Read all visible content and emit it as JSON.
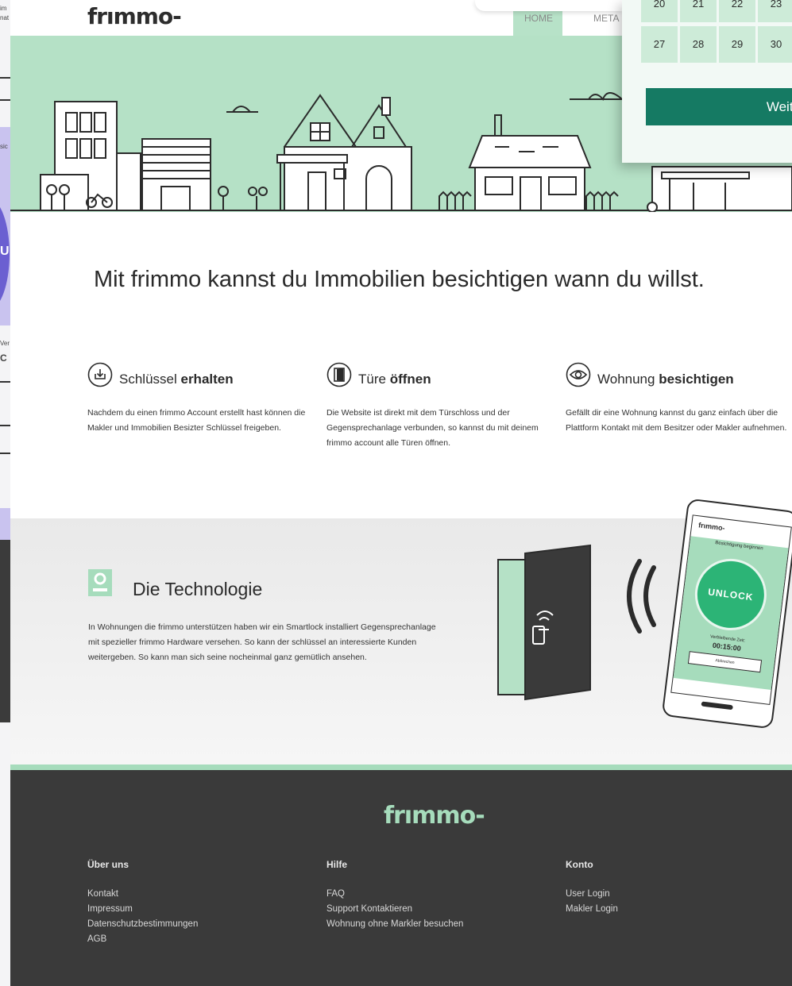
{
  "brand": {
    "logo": "frımmo-",
    "accent": "#a6dcbc",
    "dark": "#3a3a3a",
    "button": "#157a63"
  },
  "nav": {
    "home": "HOME",
    "meta": "META"
  },
  "calendar": {
    "row1": [
      "20",
      "21",
      "22",
      "23"
    ],
    "row2": [
      "27",
      "28",
      "29",
      "30"
    ],
    "button": "Weite"
  },
  "headline": "Mit frimmo kannst du Immobilien besichtigen wann du willst.",
  "features": [
    {
      "title_a": "Schlüssel ",
      "title_b": "erhalten",
      "icon": "key-download-icon",
      "text": "Nachdem du einen frimmo Account erstellt hast können die Makler und Immobilien Besizter Schlüssel freigeben."
    },
    {
      "title_a": "Türe ",
      "title_b": "öffnen",
      "icon": "door-icon",
      "text": "Die Website ist direkt mit dem Türschloss und der Gegensprechanlage verbunden, so kannst du mit deinem frimmo account alle Türen öffnen."
    },
    {
      "title_a": "Wohnung ",
      "title_b": "besichtigen",
      "icon": "eye-icon",
      "text": "Gefällt dir eine Wohnung kannst du ganz einfach über die Plattform Kontakt mit dem Besitzer oder Makler aufnehmen."
    }
  ],
  "tech": {
    "title": "Die Technologie",
    "text": "In Wohnungen die frimmo unterstützen haben wir ein Smartlock installiert Gegensprechanlage mit spezieller frimmo Hardware versehen. So kann der schlüssel an interessierte Kunden weitergeben. So kann man sich seine nocheinmal ganz gemütlich ansehen."
  },
  "phone": {
    "app_logo": "frımmo-",
    "banner": "Besichtigung beginnen",
    "unlock": "UNLOCK",
    "remaining_label": "Verbleibende Zeit:",
    "remaining_time": "00:15:00",
    "cancel": "Abbrechen"
  },
  "footer": {
    "logo": "frımmo-",
    "col1": {
      "head": "Über uns",
      "links": [
        "Kontakt",
        "Impressum",
        "Datenschutzbestimmungen",
        "AGB"
      ]
    },
    "col2": {
      "head": "Hilfe",
      "links": [
        "FAQ",
        "Support Kontaktieren",
        "Wohnung ohne Markler besuchen"
      ]
    },
    "col3": {
      "head": "Konto",
      "links": [
        "User Login",
        "Makler Login"
      ]
    }
  },
  "left_peek": {
    "t1": "im",
    "t2": "nat",
    "t3": "sic",
    "t4": "U",
    "t5": "Ver",
    "t6": "C"
  }
}
